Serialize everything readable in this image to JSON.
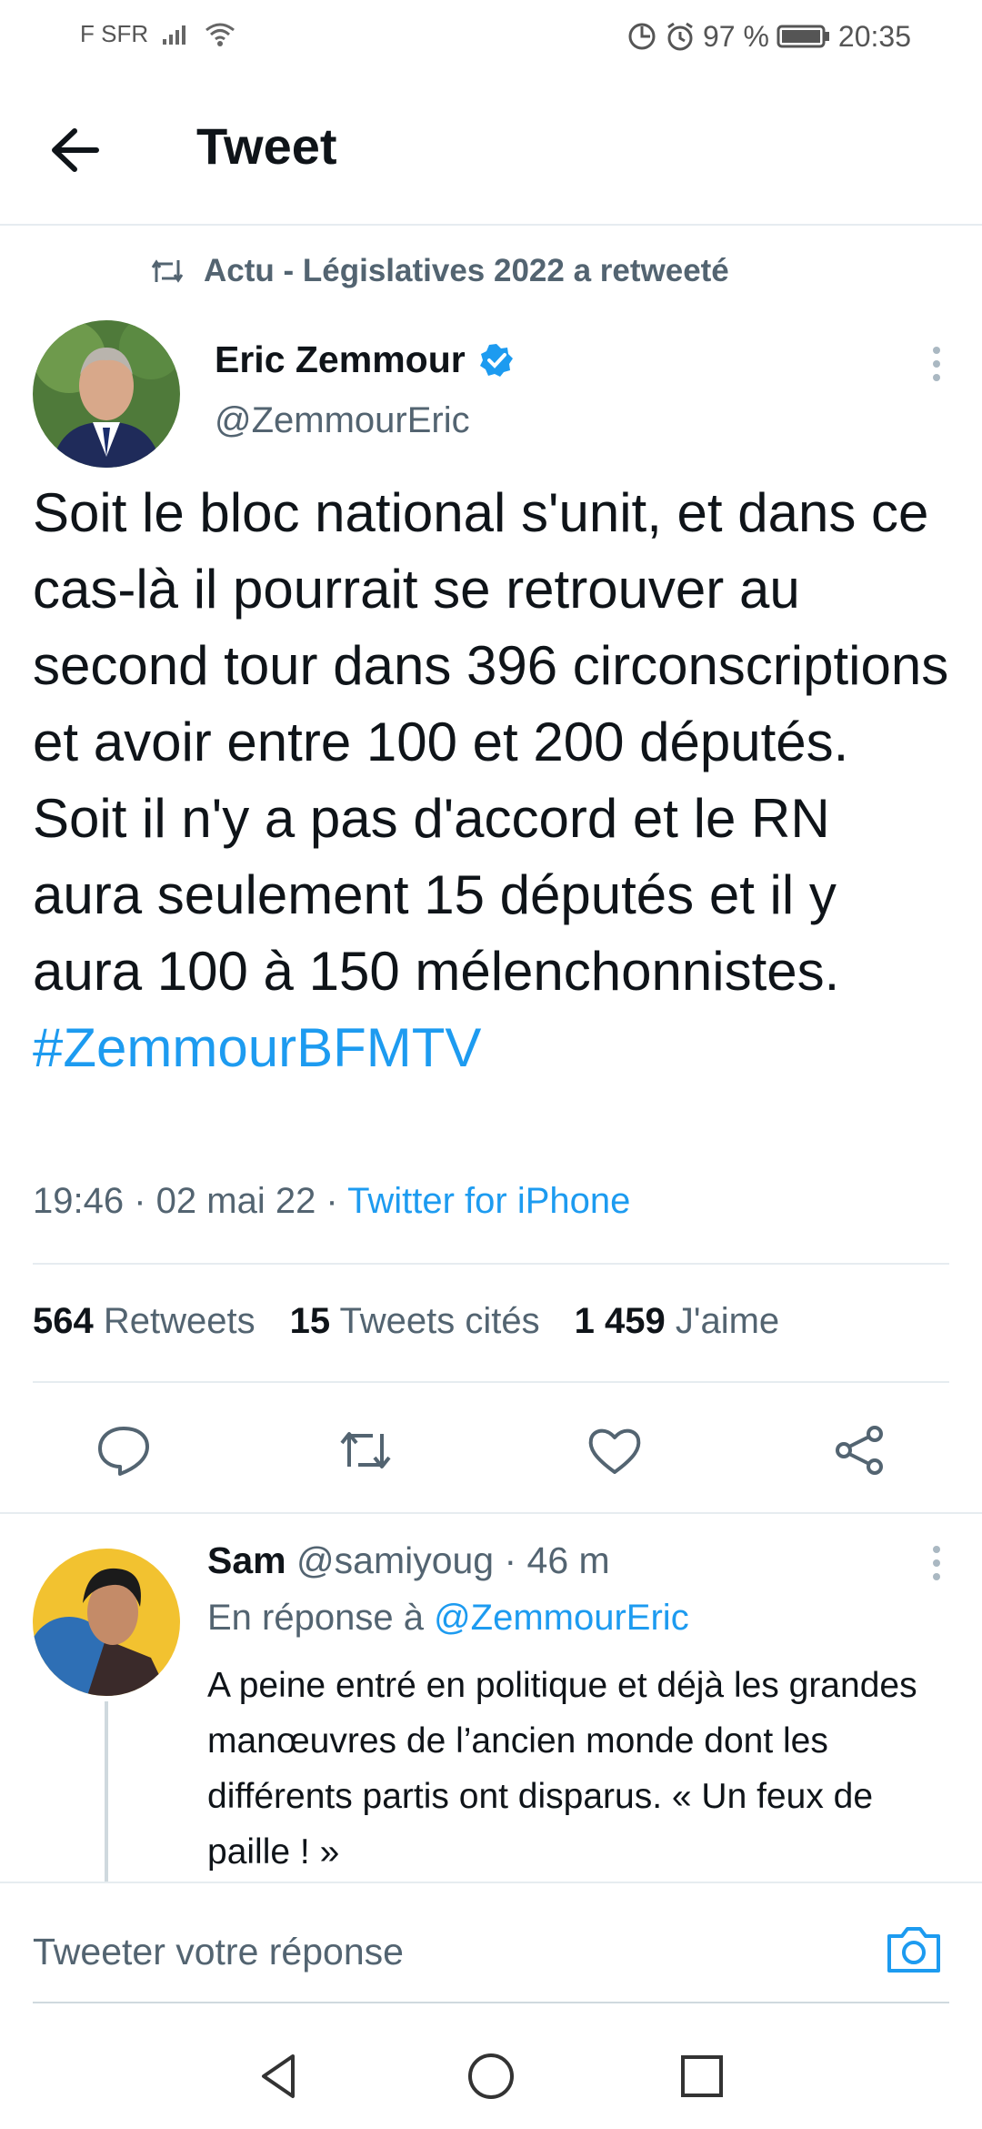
{
  "status_bar": {
    "carrier": "F SFR",
    "battery_percent": "97 %",
    "time": "20:35",
    "icons": [
      "signal-icon",
      "wifi-icon",
      "data-saver-icon",
      "alarm-icon",
      "battery-icon"
    ]
  },
  "header": {
    "title": "Tweet",
    "back_icon": "back-arrow-icon"
  },
  "retweet_context": {
    "text": "Actu - Législatives 2022 a retweeté",
    "icon": "retweet-icon"
  },
  "tweet": {
    "author_name": "Eric Zemmour",
    "verified": true,
    "author_handle": "@ZemmourEric",
    "text": "Soit le bloc national s'unit, et dans ce cas-là il pourrait se retrouver au second tour dans 396 circonscriptions et avoir entre 100 et 200 députés. Soit il n'y a pas d'accord et le RN aura seulement 15 députés et il y aura 100 à 150 mélenchonnistes.",
    "hashtag": "#ZemmourBFMTV",
    "timestamp": "19:46 · 02 mai 22 · ",
    "source": "Twitter for iPhone",
    "stats": {
      "retweets_count": "564",
      "retweets_label": "Retweets",
      "quotes_count": "15",
      "quotes_label": "Tweets cités",
      "likes_count": "1 459",
      "likes_label": "J'aime"
    },
    "actions": [
      "reply-icon",
      "retweet-icon",
      "like-icon",
      "share-icon"
    ]
  },
  "reply": {
    "name": "Sam",
    "handle_time": "@samiyoug · 46 m",
    "reply_to_label": "En réponse à ",
    "reply_to_handle": "@ZemmourEric",
    "text": "A peine entré en politique et déjà les grandes manœuvres de l’ancien monde dont les différents partis ont disparus. « Un feux de paille ! »"
  },
  "compose": {
    "placeholder": "Tweeter votre réponse",
    "icon": "camera-icon"
  },
  "accent_color": "#1d9bf0",
  "nav_icons": [
    "nav-back-icon",
    "nav-home-icon",
    "nav-recents-icon"
  ]
}
